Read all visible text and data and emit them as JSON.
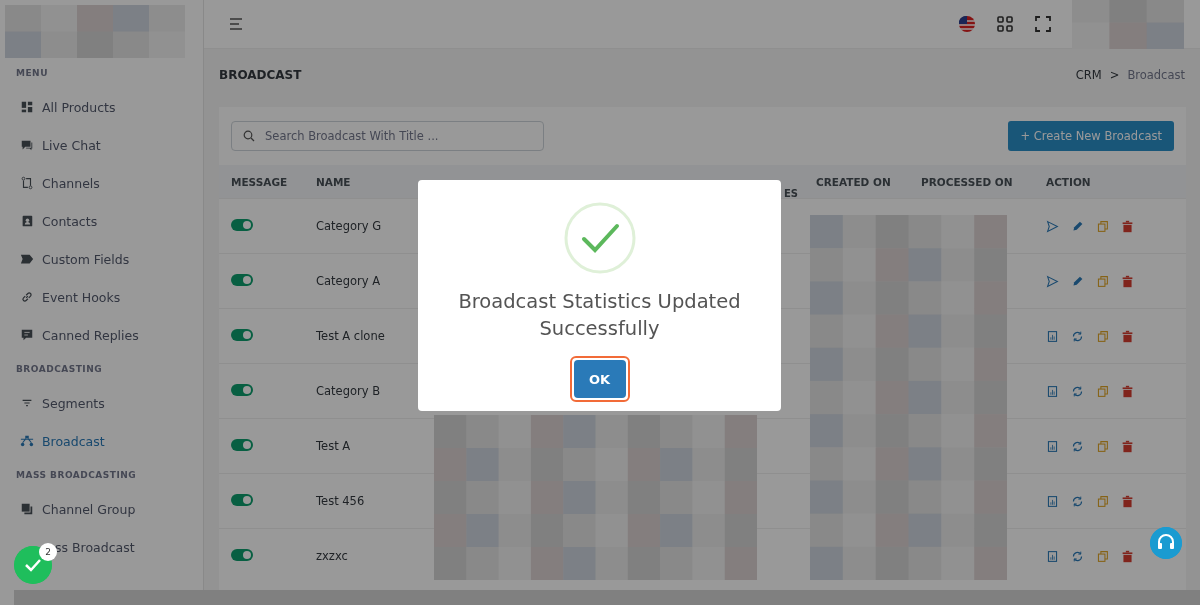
{
  "sidebar": {
    "sections": [
      {
        "title": "MENU",
        "items": [
          {
            "label": "All Products",
            "selected": false
          },
          {
            "label": "Live Chat",
            "selected": false
          },
          {
            "label": "Channels",
            "selected": false
          },
          {
            "label": "Contacts",
            "selected": false
          },
          {
            "label": "Custom Fields",
            "selected": false
          },
          {
            "label": "Event Hooks",
            "selected": false
          },
          {
            "label": "Canned Replies",
            "selected": false
          }
        ]
      },
      {
        "title": "BROADCASTING",
        "items": [
          {
            "label": "Segments",
            "selected": false
          },
          {
            "label": "Broadcast",
            "selected": true
          }
        ]
      },
      {
        "title": "MASS BROADCASTING",
        "items": [
          {
            "label": "Channel Group",
            "selected": false
          },
          {
            "label": "ss Broadcast",
            "selected": false
          }
        ]
      }
    ]
  },
  "page": {
    "title": "BROADCAST",
    "breadcrumb": [
      "CRM",
      "Broadcast"
    ],
    "breadcrumb_separator": ">"
  },
  "search": {
    "placeholder": "Search Broadcast With Title ..."
  },
  "create_button": "+ Create New Broadcast",
  "table": {
    "columns": [
      "MESSAGE",
      "NAME",
      "ES",
      "CREATED ON",
      "PROCESSED ON",
      "ACTION"
    ],
    "rows": [
      {
        "on": true,
        "name": "Category G",
        "kind": "draft"
      },
      {
        "on": true,
        "name": "Category A",
        "kind": "draft"
      },
      {
        "on": true,
        "name": "Test A clone",
        "kind": "processed"
      },
      {
        "on": true,
        "name": "Category B",
        "kind": "processed"
      },
      {
        "on": true,
        "name": "Test A",
        "kind": "processed"
      },
      {
        "on": true,
        "name": "Test 456",
        "kind": "processed"
      },
      {
        "on": true,
        "name": "zxzxc",
        "kind": "processed"
      }
    ]
  },
  "dialog": {
    "title": "Broadcast Statistics Updated Successfully",
    "button": "OK"
  },
  "notification_badge": "2"
}
